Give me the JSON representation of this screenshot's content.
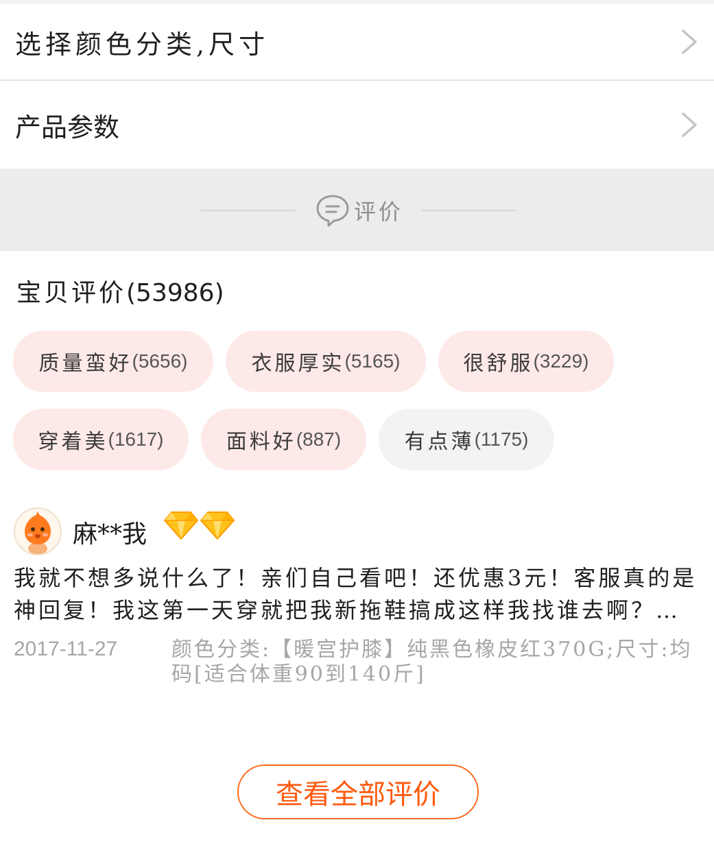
{
  "sku_row": {
    "label": "选择颜色分类,尺寸"
  },
  "params_row": {
    "label": "产品参数"
  },
  "section": {
    "title": "评价"
  },
  "ratings": {
    "title": "宝贝评价",
    "count": "(53986)",
    "tags": [
      {
        "text": "质量蛮好",
        "count": "(5656)",
        "kind": "positive"
      },
      {
        "text": "衣服厚实",
        "count": "(5165)",
        "kind": "positive"
      },
      {
        "text": "很舒服",
        "count": "(3229)",
        "kind": "positive"
      },
      {
        "text": "穿着美",
        "count": "(1617)",
        "kind": "positive"
      },
      {
        "text": "面料好",
        "count": "(887)",
        "kind": "positive"
      },
      {
        "text": "有点薄",
        "count": "(1175)",
        "kind": "neutral"
      }
    ]
  },
  "review": {
    "username": "麻**我",
    "badges": [
      "diamond-icon",
      "diamond-icon"
    ],
    "text": "我就不想多说什么了！亲们自己看吧！还优惠3元！客服真的是神回复！我这第一天穿就把我新拖鞋搞成这样我找谁去啊？还让我等几天",
    "date": "2017-11-27",
    "sku": "颜色分类:【暖宫护膝】纯黑色橡皮红370G;尺寸:均码[适合体重90到140斤]"
  },
  "view_all": {
    "label": "查看全部评价"
  },
  "colors": {
    "accent": "#ff5a0f",
    "tag_positive_bg": "#fde9e8",
    "tag_neutral_bg": "#f3f3f3",
    "section_bg": "#ececec"
  }
}
